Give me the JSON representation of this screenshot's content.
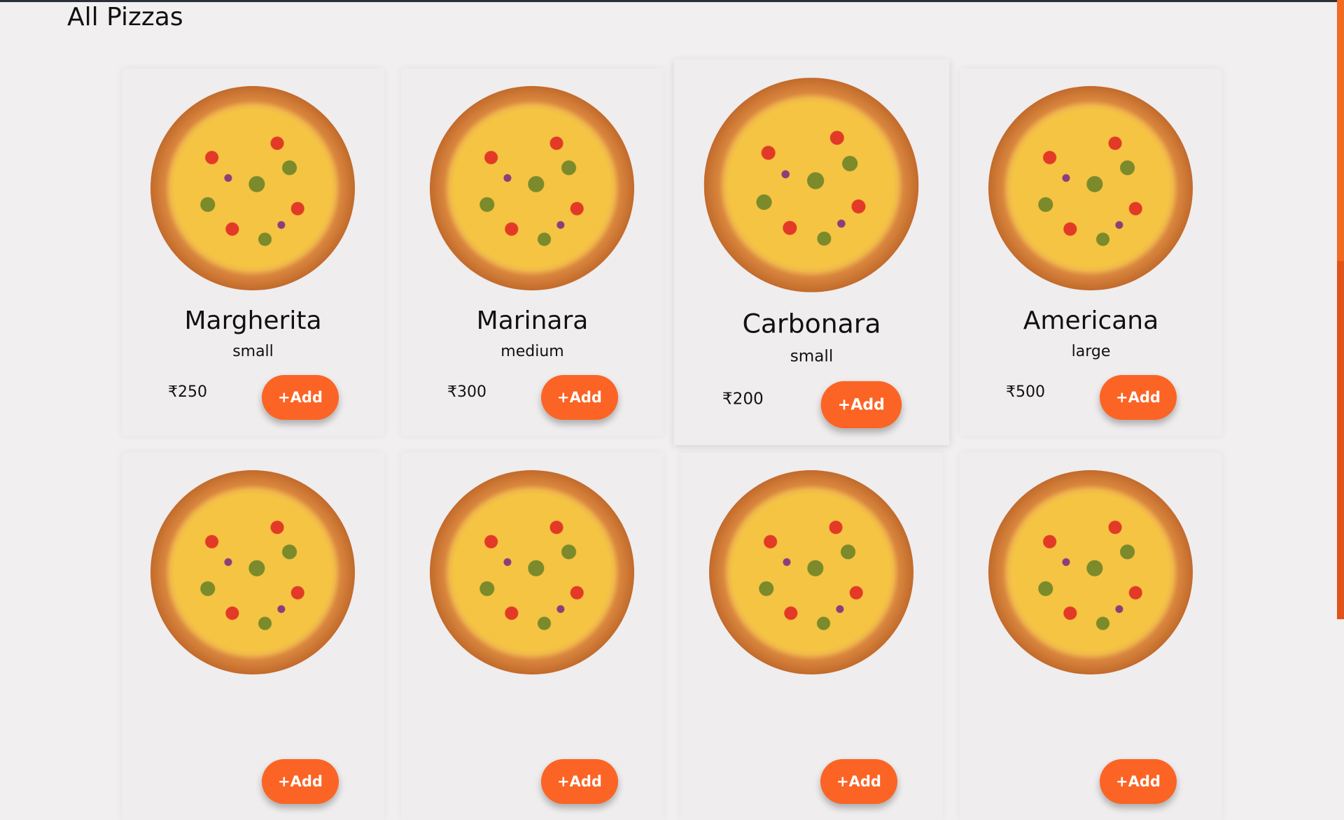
{
  "page": {
    "title": "All Pizzas"
  },
  "currency_symbol": "₹",
  "pizzas": [
    {
      "name": "Margherita",
      "size": "small",
      "price": "₹250",
      "add_label": "+Add"
    },
    {
      "name": "Marinara",
      "size": "medium",
      "price": "₹300",
      "add_label": "+Add"
    },
    {
      "name": "Carbonara",
      "size": "small",
      "price": "₹200",
      "add_label": "+Add"
    },
    {
      "name": "Americana",
      "size": "large",
      "price": "₹500",
      "add_label": "+Add"
    },
    {
      "name": "",
      "size": "",
      "price": "",
      "add_label": "+Add"
    },
    {
      "name": "",
      "size": "",
      "price": "",
      "add_label": "+Add"
    },
    {
      "name": "",
      "size": "",
      "price": "",
      "add_label": "+Add"
    },
    {
      "name": "",
      "size": "",
      "price": "",
      "add_label": "+Add"
    }
  ],
  "colors": {
    "accent": "#fb6424",
    "background": "#f1eff0",
    "card": "#efedee",
    "text": "#111111"
  },
  "icons": {
    "pizza_image": "pizza-image"
  }
}
